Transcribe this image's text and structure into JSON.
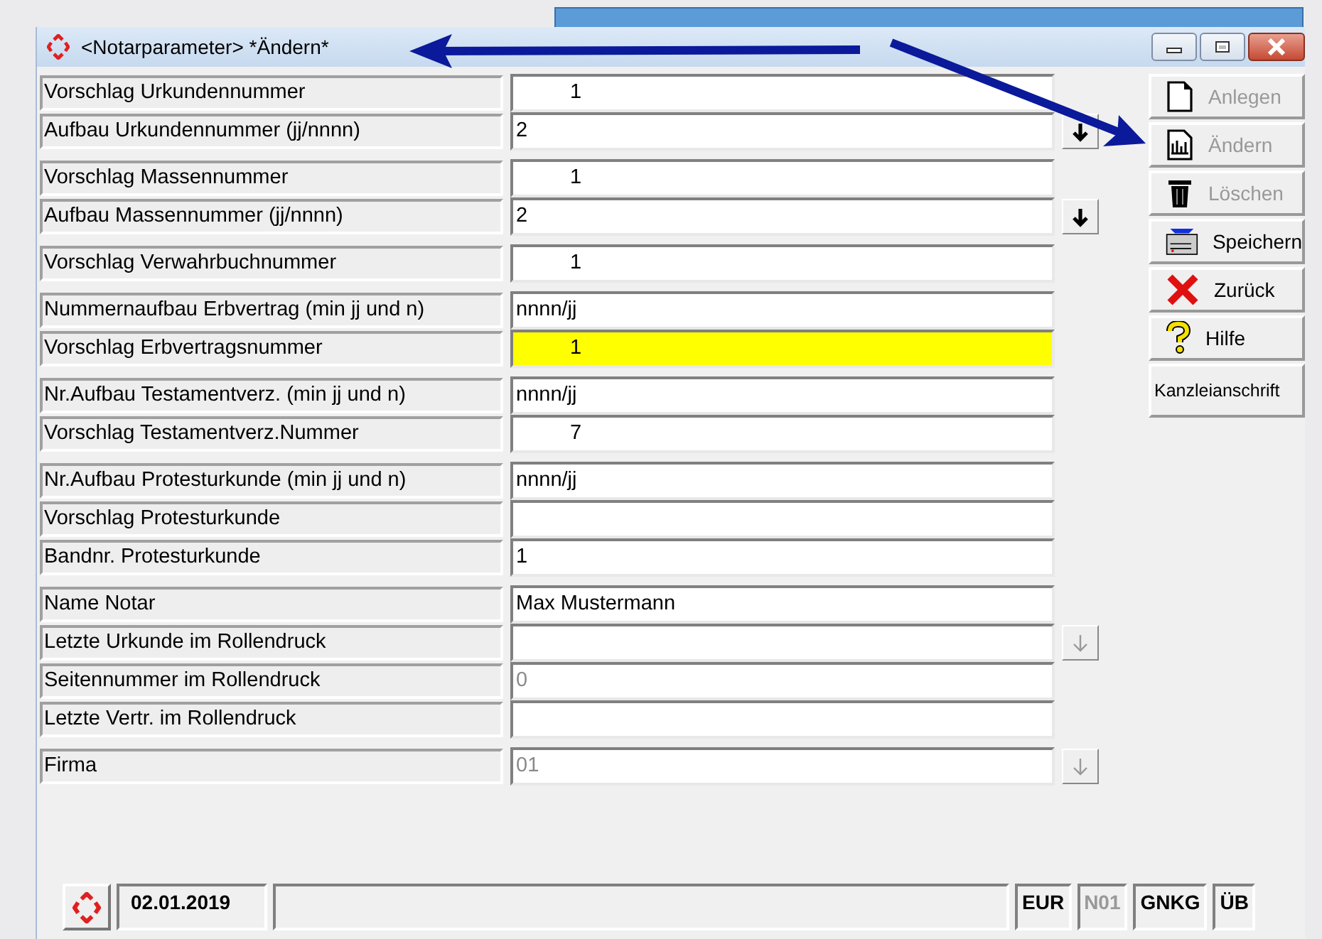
{
  "window": {
    "title": "<Notarparameter>  *Ändern*"
  },
  "groups": [
    {
      "rows": [
        {
          "label": "Vorschlag Urkundennummer",
          "value": "1",
          "kind": "counter",
          "disabled": false,
          "highlighted": false
        },
        {
          "label": "Aufbau Urkundennummer (jj/nnnn)",
          "value": "2",
          "kind": "text",
          "disabled": false,
          "highlighted": false,
          "dropdown": {
            "disabled": false
          }
        }
      ]
    },
    {
      "rows": [
        {
          "label": "Vorschlag Massennummer",
          "value": "1",
          "kind": "counter",
          "disabled": false,
          "highlighted": false
        },
        {
          "label": "Aufbau Massennummer (jj/nnnn)",
          "value": "2",
          "kind": "text",
          "disabled": false,
          "highlighted": false,
          "dropdown": {
            "disabled": false
          }
        }
      ]
    },
    {
      "rows": [
        {
          "label": "Vorschlag Verwahrbuchnummer",
          "value": "1",
          "kind": "counter",
          "disabled": false,
          "highlighted": false
        }
      ]
    },
    {
      "rows": [
        {
          "label": "Nummernaufbau Erbvertrag (min jj und n)",
          "value": "nnnn/jj",
          "kind": "text",
          "disabled": false,
          "highlighted": false
        },
        {
          "label": "Vorschlag Erbvertragsnummer",
          "value": "1",
          "kind": "counter",
          "disabled": false,
          "highlighted": true
        }
      ]
    },
    {
      "rows": [
        {
          "label": "Nr.Aufbau Testamentverz. (min jj und n)",
          "value": "nnnn/jj",
          "kind": "text",
          "disabled": false,
          "highlighted": false
        },
        {
          "label": "Vorschlag Testamentverz.Nummer",
          "value": "7",
          "kind": "counter",
          "disabled": false,
          "highlighted": false
        }
      ]
    },
    {
      "rows": [
        {
          "label": "Nr.Aufbau Protesturkunde (min jj und n)",
          "value": "nnnn/jj",
          "kind": "text",
          "disabled": false,
          "highlighted": false
        },
        {
          "label": "Vorschlag Protesturkunde",
          "kind": "text",
          "highlighted": false
        },
        {
          "label": "Bandnr. Protesturkunde",
          "value": "1",
          "kind": "text",
          "disabled": false,
          "highlighted": false
        }
      ]
    },
    {
      "rows": [
        {
          "label": "Name Notar",
          "value": "Max Mustermann",
          "kind": "text",
          "disabled": false,
          "highlighted": false
        },
        {
          "label": "Letzte Urkunde im Rollendruck",
          "kind": "text",
          "highlighted": false,
          "dropdown": {
            "disabled": true
          }
        },
        {
          "label": "Seitennummer im Rollendruck",
          "value": "0",
          "kind": "text",
          "disabled": true,
          "highlighted": false
        },
        {
          "label": "Letzte Vertr. im Rollendruck",
          "kind": "text",
          "highlighted": false
        }
      ]
    },
    {
      "rows": [
        {
          "label": "Firma",
          "value": "01",
          "kind": "text",
          "disabled": true,
          "highlighted": false,
          "dropdown": {
            "disabled": true
          }
        }
      ]
    }
  ],
  "buttons": [
    {
      "label": "Anlegen",
      "kind": "new",
      "disabled": true
    },
    {
      "label": "Ändern",
      "kind": "edit",
      "disabled": true
    },
    {
      "label": "Löschen",
      "kind": "delete",
      "disabled": true
    },
    {
      "label": "Speichern",
      "kind": "save",
      "disabled": false
    },
    {
      "label": "Zurück",
      "kind": "back",
      "disabled": false
    },
    {
      "label": "Hilfe",
      "kind": "help",
      "disabled": false
    },
    {
      "label": "Kanzleianschrift",
      "kind": "plain",
      "disabled": false
    }
  ],
  "status_bar": {
    "date": "02.01.2019",
    "cells": [
      {
        "text": "EUR",
        "disabled": false
      },
      {
        "text": "N01",
        "disabled": true
      },
      {
        "text": "GNKG",
        "disabled": false
      },
      {
        "text": "ÜB",
        "disabled": false
      }
    ]
  }
}
